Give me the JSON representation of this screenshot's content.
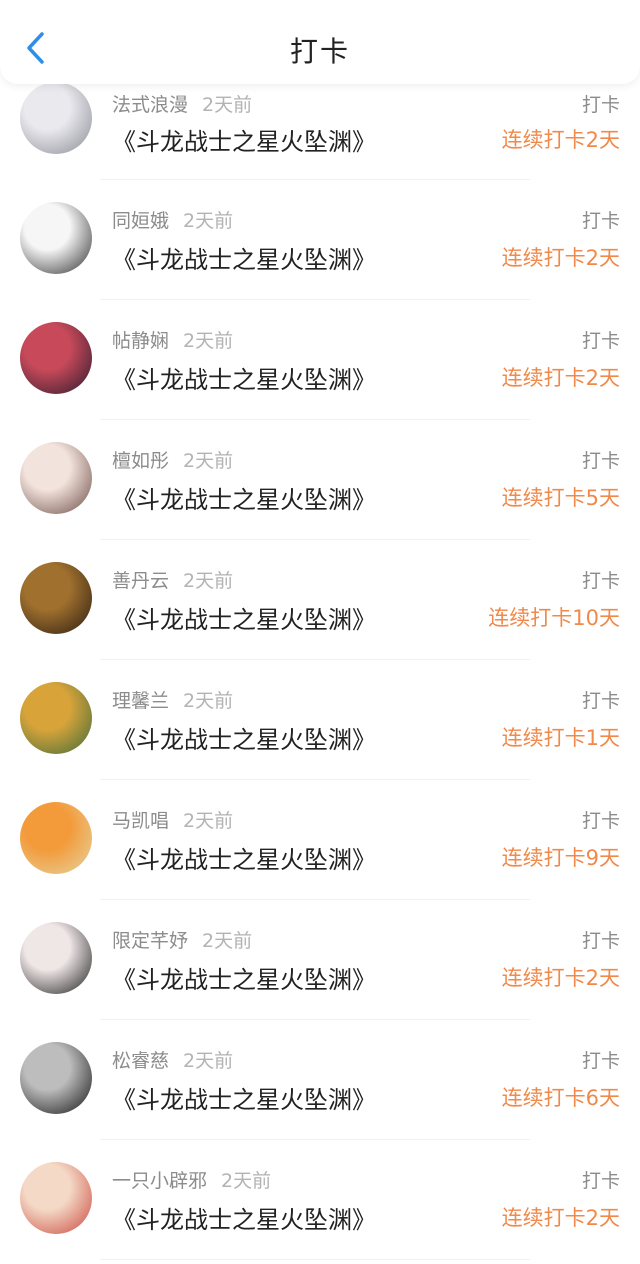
{
  "header": {
    "title": "打卡",
    "back_icon": "chevron-left-icon",
    "accent": "#2f8fe8"
  },
  "colors": {
    "streak": "#f0894a",
    "muted": "#8c8c8c"
  },
  "items": [
    {
      "name": "法式浪漫",
      "time": "2天前",
      "book": "《斗龙战士之星火坠渊》",
      "action": "打卡",
      "streak": "连续打卡2天",
      "avatar_colors": [
        "#e9e9ee",
        "#8a8a93"
      ]
    },
    {
      "name": "同姮娥",
      "time": "2天前",
      "book": "《斗龙战士之星火坠渊》",
      "action": "打卡",
      "streak": "连续打卡2天",
      "avatar_colors": [
        "#f6f6f6",
        "#2b2b2b"
      ]
    },
    {
      "name": "帖静娴",
      "time": "2天前",
      "book": "《斗龙战士之星火坠渊》",
      "action": "打卡",
      "streak": "连续打卡2天",
      "avatar_colors": [
        "#c84a5a",
        "#2a1a2e"
      ]
    },
    {
      "name": "檀如彤",
      "time": "2天前",
      "book": "《斗龙战士之星火坠渊》",
      "action": "打卡",
      "streak": "连续打卡5天",
      "avatar_colors": [
        "#f2e3dc",
        "#6b4a44"
      ]
    },
    {
      "name": "善丹云",
      "time": "2天前",
      "book": "《斗龙战士之星火坠渊》",
      "action": "打卡",
      "streak": "连续打卡10天",
      "avatar_colors": [
        "#a0702e",
        "#2a1c12"
      ]
    },
    {
      "name": "理馨兰",
      "time": "2天前",
      "book": "《斗龙战士之星火坠渊》",
      "action": "打卡",
      "streak": "连续打卡1天",
      "avatar_colors": [
        "#d8a43a",
        "#3d6a3a"
      ]
    },
    {
      "name": "马凯唱",
      "time": "2天前",
      "book": "《斗龙战士之星火坠渊》",
      "action": "打卡",
      "streak": "连续打卡9天",
      "avatar_colors": [
        "#f39a3a",
        "#e5d6a2"
      ]
    },
    {
      "name": "限定芊妤",
      "time": "2天前",
      "book": "《斗龙战士之星火坠渊》",
      "action": "打卡",
      "streak": "连续打卡2天",
      "avatar_colors": [
        "#efe6e6",
        "#1b1b1b"
      ]
    },
    {
      "name": "松睿慈",
      "time": "2天前",
      "book": "《斗龙战士之星火坠渊》",
      "action": "打卡",
      "streak": "连续打卡6天",
      "avatar_colors": [
        "#bdbdbd",
        "#111111"
      ]
    },
    {
      "name": "一只小辟邪",
      "time": "2天前",
      "book": "《斗龙战士之星火坠渊》",
      "action": "打卡",
      "streak": "连续打卡2天",
      "avatar_colors": [
        "#f4d9c6",
        "#c9453a"
      ]
    }
  ]
}
